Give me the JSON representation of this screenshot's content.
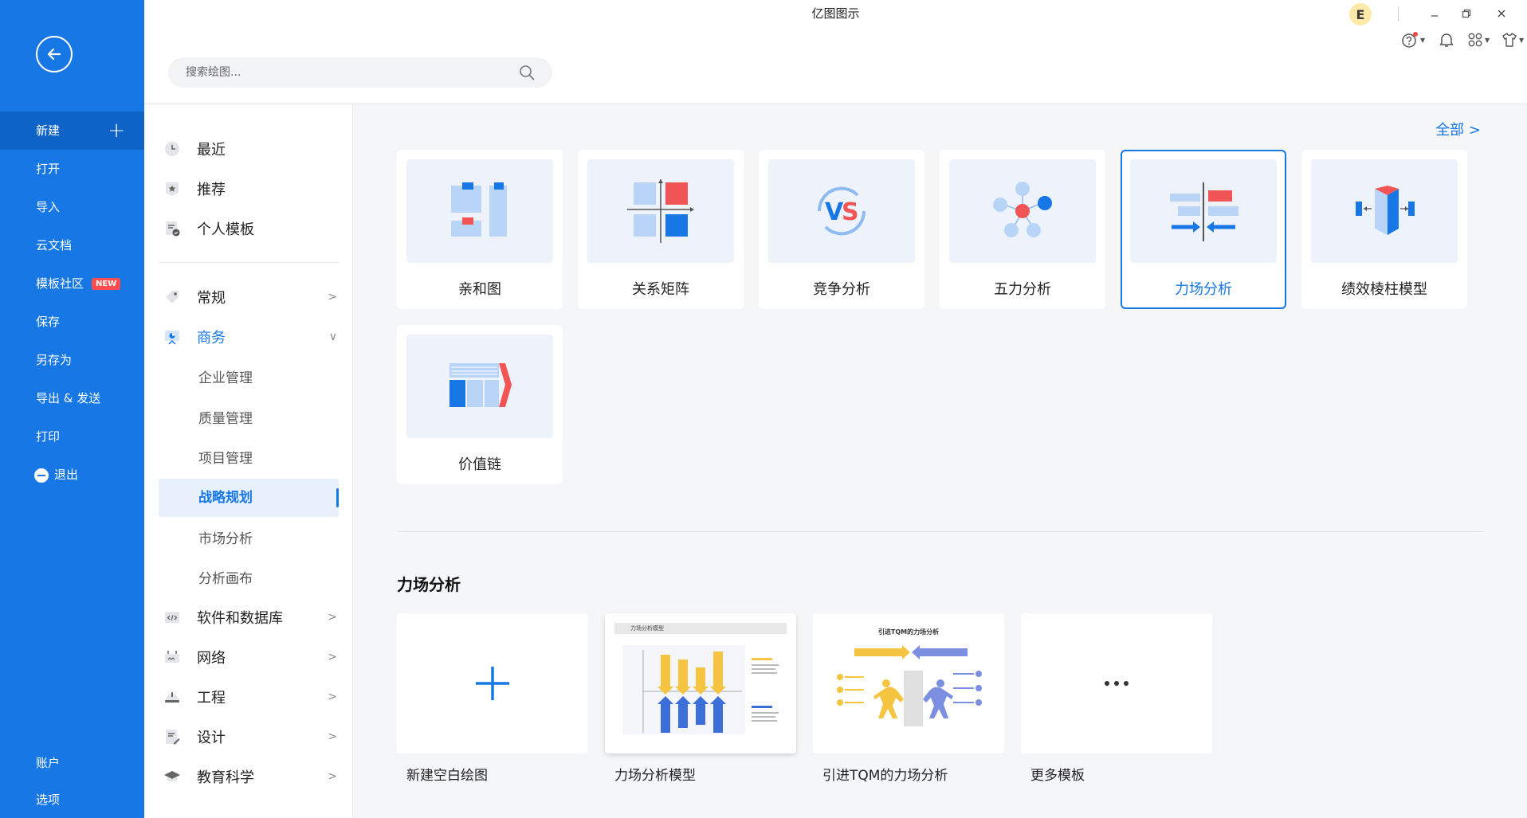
{
  "app": {
    "title": "亿图图示"
  },
  "sidebar": {
    "menu": [
      {
        "label": "新建"
      },
      {
        "label": "打开"
      },
      {
        "label": "导入"
      },
      {
        "label": "云文档"
      },
      {
        "label": "模板社区",
        "badge": "NEW"
      },
      {
        "label": "保存"
      },
      {
        "label": "另存为"
      },
      {
        "label": "导出 & 发送"
      },
      {
        "label": "打印"
      },
      {
        "label": "退出"
      }
    ],
    "bottom": [
      {
        "label": "账户"
      },
      {
        "label": "选项"
      }
    ]
  },
  "header": {
    "search_placeholder": "搜索绘图...",
    "avatar_letter": "E"
  },
  "categories": {
    "top": [
      {
        "label": "最近",
        "icon": "clock-icon"
      },
      {
        "label": "推荐",
        "icon": "star-tag-icon"
      },
      {
        "label": "个人模板",
        "icon": "personal-template-icon"
      }
    ],
    "main": [
      {
        "label": "常规",
        "icon": "tag-icon"
      },
      {
        "label": "商务",
        "icon": "business-icon"
      },
      {
        "label": "软件和数据库",
        "icon": "code-icon"
      },
      {
        "label": "网络",
        "icon": "network-icon"
      },
      {
        "label": "工程",
        "icon": "helmet-icon"
      },
      {
        "label": "设计",
        "icon": "design-icon"
      },
      {
        "label": "教育科学",
        "icon": "graduation-icon"
      }
    ],
    "business_sub": [
      "企业管理",
      "质量管理",
      "项目管理",
      "战略规划",
      "市场分析",
      "分析画布"
    ],
    "active_sub": "战略规划"
  },
  "main": {
    "all_link": "全部  >",
    "diagram_types": [
      {
        "label": "亲和图"
      },
      {
        "label": "关系矩阵"
      },
      {
        "label": "竞争分析"
      },
      {
        "label": "五力分析"
      },
      {
        "label": "力场分析"
      },
      {
        "label": "绩效棱柱模型"
      },
      {
        "label": "价值链"
      }
    ],
    "selected_type": "力场分析",
    "section_title": "力场分析",
    "templates": [
      {
        "label": "新建空白绘图"
      },
      {
        "label": "力场分析模型",
        "preview_title": "力场分析模型"
      },
      {
        "label": "引进TQM的力场分析",
        "preview_title": "引进TQM的力场分析"
      },
      {
        "label": "更多模板"
      }
    ]
  },
  "colors": {
    "accent": "#1677e5",
    "red": "#f05454",
    "yellow": "#f5c542"
  }
}
